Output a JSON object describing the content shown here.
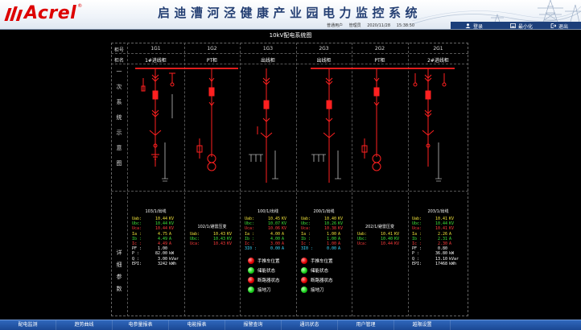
{
  "header": {
    "brand": "Acrel",
    "registered": "®",
    "title": "启迪漕河泾健康产业园电力监控系统",
    "user_role": "普通用户",
    "user_name": "管理员",
    "date": "2020/11/28",
    "time": "15:38:50",
    "login_label": "登录",
    "minimize_label": "最小化",
    "exit_label": "退出"
  },
  "diagram": {
    "title": "10kV配电系统图",
    "row_labels": {
      "cabinet_no": "柜号",
      "cabinet_name": "柜名"
    },
    "section_primary": [
      "一",
      "次",
      "系",
      "统",
      "示",
      "意",
      "图"
    ],
    "section_detail": [
      "详",
      "细",
      "参",
      "数"
    ],
    "cabinets": [
      {
        "no": "1G1",
        "name": "1#进线柜"
      },
      {
        "no": "1G2",
        "name": "PT柜"
      },
      {
        "no": "1G3",
        "name": "出线柜"
      },
      {
        "no": "2G3",
        "name": "出线柜"
      },
      {
        "no": "2G2",
        "name": "PT柜"
      },
      {
        "no": "2G1",
        "name": "2#进线柜"
      }
    ]
  },
  "panels": {
    "p1": {
      "title": "103/1/出线",
      "rows": [
        {
          "k": "Uab:",
          "v": "10.44",
          "u": "KV",
          "color": "y"
        },
        {
          "k": "Ubc:",
          "v": "10.44",
          "u": "KV",
          "color": "g"
        },
        {
          "k": "Uca:",
          "v": "10.44",
          "u": "KV",
          "color": "r"
        },
        {
          "k": "Ia :",
          "v": "4.75",
          "u": "A",
          "color": "y"
        },
        {
          "k": "Ib :",
          "v": "4.49",
          "u": "A",
          "color": "g"
        },
        {
          "k": "Ic :",
          "v": "4.49",
          "u": "A",
          "color": "r"
        },
        {
          "k": "PF :",
          "v": "1.00",
          "u": "",
          "color": "w"
        },
        {
          "k": "P  :",
          "v": "82.00",
          "u": "kW",
          "color": "w"
        },
        {
          "k": "Q  :",
          "v": "3.00",
          "u": "kVar",
          "color": "w"
        },
        {
          "k": "EPI:",
          "v": "3242",
          "u": "kWh",
          "color": "w"
        }
      ]
    },
    "p2": {
      "title": "102/1/避雷压变",
      "rows": [
        {
          "k": "Uab:",
          "v": "10.43",
          "u": "KV",
          "color": "y"
        },
        {
          "k": "Ubc:",
          "v": "10.43",
          "u": "KV",
          "color": "g"
        },
        {
          "k": "Uca:",
          "v": "10.43",
          "u": "KV",
          "color": "r"
        }
      ]
    },
    "p3": {
      "title": "100/1/出线",
      "rows": [
        {
          "k": "Uab:",
          "v": "10.45",
          "u": "KV",
          "color": "y"
        },
        {
          "k": "Ubc:",
          "v": "10.07",
          "u": "KV",
          "color": "g"
        },
        {
          "k": "Uca:",
          "v": "10.06",
          "u": "KV",
          "color": "r"
        },
        {
          "k": "Ia :",
          "v": "4.00",
          "u": "A",
          "color": "y"
        },
        {
          "k": "Ib :",
          "v": "4.00",
          "u": "A",
          "color": "g"
        },
        {
          "k": "Ic :",
          "v": "3.00",
          "u": "A",
          "color": "r"
        },
        {
          "k": "3I0 :",
          "v": "0.00",
          "u": "A",
          "color": "c"
        }
      ],
      "status": [
        {
          "label": "手推车位置",
          "state": "red"
        },
        {
          "label": "储能状态",
          "state": "green"
        },
        {
          "label": "断路器状态",
          "state": "red"
        },
        {
          "label": "接地刀",
          "state": "green"
        }
      ]
    },
    "p4": {
      "title": "200/1/出线",
      "rows": [
        {
          "k": "Uab:",
          "v": "10.40",
          "u": "KV",
          "color": "y"
        },
        {
          "k": "Ubc:",
          "v": "10.26",
          "u": "KV",
          "color": "g"
        },
        {
          "k": "Uca:",
          "v": "10.38",
          "u": "KV",
          "color": "r"
        },
        {
          "k": "Ia :",
          "v": "1.00",
          "u": "A",
          "color": "y"
        },
        {
          "k": "Ib :",
          "v": "1.00",
          "u": "A",
          "color": "g"
        },
        {
          "k": "Ic :",
          "v": "1.00",
          "u": "A",
          "color": "r"
        },
        {
          "k": "3I0 :",
          "v": "0.00",
          "u": "A",
          "color": "c"
        }
      ],
      "status": [
        {
          "label": "手推车位置",
          "state": "red"
        },
        {
          "label": "储能状态",
          "state": "green"
        },
        {
          "label": "断路器状态",
          "state": "red"
        },
        {
          "label": "接地刀",
          "state": "green"
        }
      ]
    },
    "p5": {
      "title": "202/1/避雷压变",
      "rows": [
        {
          "k": "Uab:",
          "v": "10.41",
          "u": "KV",
          "color": "y"
        },
        {
          "k": "Ubc:",
          "v": "10.40",
          "u": "KV",
          "color": "g"
        },
        {
          "k": "Uca:",
          "v": "10.44",
          "u": "KV",
          "color": "r"
        }
      ]
    },
    "p6": {
      "title": "203/1/出线",
      "rows": [
        {
          "k": "Uab:",
          "v": "10.41",
          "u": "KV",
          "color": "y"
        },
        {
          "k": "Ubc:",
          "v": "10.44",
          "u": "KV",
          "color": "g"
        },
        {
          "k": "Uca:",
          "v": "10.41",
          "u": "KV",
          "color": "r"
        },
        {
          "k": "Ia :",
          "v": "2.26",
          "u": "A",
          "color": "y"
        },
        {
          "k": "Ib :",
          "v": "2.31",
          "u": "A",
          "color": "g"
        },
        {
          "k": "Ic :",
          "v": "2.30",
          "u": "A",
          "color": "r"
        },
        {
          "k": "PF :",
          "v": "0.80",
          "u": "",
          "color": "w"
        },
        {
          "k": "P  :",
          "v": "36.80",
          "u": "kW",
          "color": "w"
        },
        {
          "k": "Q  :",
          "v": "13.10",
          "u": "kVar",
          "color": "w"
        },
        {
          "k": "EPI:",
          "v": "17468",
          "u": "kWh",
          "color": "w"
        }
      ]
    }
  },
  "nav": {
    "items": [
      "配电监测",
      "趋势曲线",
      "电参量报表",
      "电能报表",
      "报警查询",
      "通讯状态",
      "用户管理",
      "越限设置"
    ]
  },
  "colors": {
    "line_red": "#ff2020",
    "header_text": "#243f73",
    "nav_bg": "#2f67bc"
  }
}
